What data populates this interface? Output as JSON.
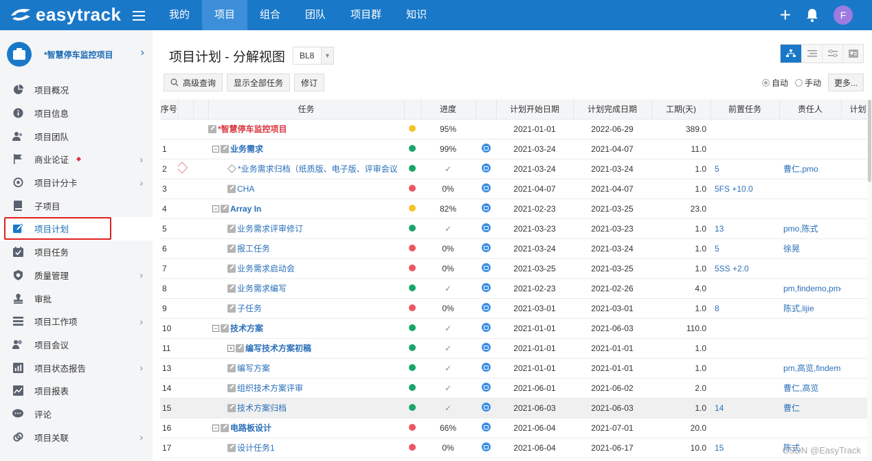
{
  "app": {
    "brand": "easytrack"
  },
  "nav": [
    {
      "label": "我的"
    },
    {
      "label": "项目",
      "active": true
    },
    {
      "label": "组合"
    },
    {
      "label": "团队"
    },
    {
      "label": "项目群"
    },
    {
      "label": "知识"
    }
  ],
  "user": {
    "avatar_letter": "F"
  },
  "project": {
    "name": "*智慧停车监控项目"
  },
  "sidebar": {
    "items": [
      {
        "label": "项目概况",
        "icon": "pie-chart-icon",
        "chevron": false
      },
      {
        "label": "项目信息",
        "icon": "info-icon",
        "chevron": false
      },
      {
        "label": "项目团队",
        "icon": "users-icon",
        "chevron": false
      },
      {
        "label": "商业论证",
        "icon": "flag-icon",
        "chevron": true,
        "badge": true
      },
      {
        "label": "项目计分卡",
        "icon": "target-icon",
        "chevron": true
      },
      {
        "label": "子项目",
        "icon": "book-icon",
        "chevron": false
      },
      {
        "label": "项目计划",
        "icon": "edit-icon",
        "chevron": false,
        "active": true
      },
      {
        "label": "项目任务",
        "icon": "calendar-check-icon",
        "chevron": false
      },
      {
        "label": "质量管理",
        "icon": "shield-icon",
        "chevron": true
      },
      {
        "label": "审批",
        "icon": "stamp-icon",
        "chevron": false
      },
      {
        "label": "项目工作项",
        "icon": "list-icon",
        "chevron": true
      },
      {
        "label": "项目会议",
        "icon": "meeting-icon",
        "chevron": false
      },
      {
        "label": "项目状态报告",
        "icon": "report-icon",
        "chevron": true
      },
      {
        "label": "项目报表",
        "icon": "line-chart-icon",
        "chevron": false
      },
      {
        "label": "评论",
        "icon": "comment-icon",
        "chevron": false
      },
      {
        "label": "项目关联",
        "icon": "link-icon",
        "chevron": true
      }
    ]
  },
  "main": {
    "title": "项目计划 - 分解视图",
    "baseline": "BL8",
    "toolbar": {
      "advanced_query": "高级查询",
      "show_all": "显示全部任务",
      "revise": "修订"
    },
    "mode": {
      "auto": "自动",
      "manual": "手动",
      "more": "更多..."
    }
  },
  "colors": {
    "accent": "#1a78c8",
    "green": "#19a56a",
    "yellow": "#f5c22b",
    "red": "#ee5562"
  },
  "table": {
    "headers": {
      "num": "序号",
      "task": "任务",
      "progress": "进度",
      "start": "计划开始日期",
      "end": "计划完成日期",
      "duration": "工期(天)",
      "pred": "前置任务",
      "owner": "责任人",
      "extra": "计划"
    },
    "rows": [
      {
        "num": "",
        "name": "*智慧停车监控项目",
        "level": 0,
        "tree": "",
        "style": "root",
        "status": "y",
        "progress": "95%",
        "ltype": false,
        "start": "2021-01-01",
        "end": "2022-06-29",
        "duration": "389.0",
        "pred": "",
        "owner": ""
      },
      {
        "num": "1",
        "name": "业务需求",
        "level": 1,
        "tree": "−",
        "style": "b",
        "status": "g",
        "progress": "99%",
        "ltype": true,
        "start": "2021-03-24",
        "end": "2021-04-07",
        "duration": "11.0",
        "pred": "",
        "owner": ""
      },
      {
        "num": "2",
        "name": "*业务需求归档（纸质版、电子版、评审会议",
        "level": 2,
        "tree": "",
        "style": "milestone",
        "status": "g",
        "progress": "✓",
        "ltype": true,
        "start": "2021-03-24",
        "end": "2021-03-24",
        "duration": "1.0",
        "pred": "5",
        "owner": "曹仁,pmo",
        "flag": true
      },
      {
        "num": "3",
        "name": "CHA",
        "level": 2,
        "tree": "",
        "style": "",
        "status": "r",
        "progress": "0%",
        "ltype": true,
        "start": "2021-04-07",
        "end": "2021-04-07",
        "duration": "1.0",
        "pred": "5FS +10.0",
        "owner": ""
      },
      {
        "num": "4",
        "name": "Array In",
        "level": 1,
        "tree": "−",
        "style": "b",
        "status": "y",
        "progress": "82%",
        "ltype": true,
        "start": "2021-02-23",
        "end": "2021-03-25",
        "duration": "23.0",
        "pred": "",
        "owner": ""
      },
      {
        "num": "5",
        "name": "业务需求评审修订",
        "level": 2,
        "tree": "",
        "style": "",
        "status": "g",
        "progress": "✓",
        "ltype": true,
        "start": "2021-03-23",
        "end": "2021-03-23",
        "duration": "1.0",
        "pred": "13",
        "owner": "pmo,陈式"
      },
      {
        "num": "6",
        "name": "报工任务",
        "level": 2,
        "tree": "",
        "style": "",
        "status": "r",
        "progress": "0%",
        "ltype": true,
        "start": "2021-03-24",
        "end": "2021-03-24",
        "duration": "1.0",
        "pred": "5",
        "owner": "徐晃"
      },
      {
        "num": "7",
        "name": "业务需求启动会",
        "level": 2,
        "tree": "",
        "style": "",
        "status": "r",
        "progress": "0%",
        "ltype": true,
        "start": "2021-03-25",
        "end": "2021-03-25",
        "duration": "1.0",
        "pred": "5SS +2.0",
        "owner": ""
      },
      {
        "num": "8",
        "name": "业务需求编写",
        "level": 2,
        "tree": "",
        "style": "",
        "status": "g",
        "progress": "✓",
        "ltype": true,
        "start": "2021-02-23",
        "end": "2021-02-26",
        "duration": "4.0",
        "pred": "",
        "owner": "pm,findemo,pmo"
      },
      {
        "num": "9",
        "name": "子任务",
        "level": 2,
        "tree": "",
        "style": "",
        "status": "r",
        "progress": "0%",
        "ltype": true,
        "start": "2021-03-01",
        "end": "2021-03-01",
        "duration": "1.0",
        "pred": "8",
        "owner": "陈式,lijie"
      },
      {
        "num": "10",
        "name": "技术方案",
        "level": 1,
        "tree": "−",
        "style": "b",
        "status": "g",
        "progress": "✓",
        "ltype": true,
        "start": "2021-01-01",
        "end": "2021-06-03",
        "duration": "110.0",
        "pred": "",
        "owner": ""
      },
      {
        "num": "11",
        "name": "编写技术方案初稿",
        "level": 2,
        "tree": "+",
        "style": "b",
        "status": "g",
        "progress": "✓",
        "ltype": true,
        "start": "2021-01-01",
        "end": "2021-01-01",
        "duration": "1.0",
        "pred": "",
        "owner": ""
      },
      {
        "num": "13",
        "name": "编写方案",
        "level": 2,
        "tree": "",
        "style": "",
        "status": "g",
        "progress": "✓",
        "ltype": true,
        "start": "2021-01-01",
        "end": "2021-01-01",
        "duration": "1.0",
        "pred": "",
        "owner": "pm,高览,findemo"
      },
      {
        "num": "14",
        "name": "组织技术方案评审",
        "level": 2,
        "tree": "",
        "style": "",
        "status": "g",
        "progress": "✓",
        "ltype": true,
        "start": "2021-06-01",
        "end": "2021-06-02",
        "duration": "2.0",
        "pred": "",
        "owner": "曹仁,高览"
      },
      {
        "num": "15",
        "name": "技术方案归档",
        "level": 2,
        "tree": "",
        "style": "",
        "status": "g",
        "progress": "✓",
        "ltype": true,
        "start": "2021-06-03",
        "end": "2021-06-03",
        "duration": "1.0",
        "pred": "14",
        "owner": "曹仁",
        "selected": true
      },
      {
        "num": "16",
        "name": "电路板设计",
        "level": 1,
        "tree": "−",
        "style": "b",
        "status": "r",
        "progress": "66%",
        "ltype": true,
        "start": "2021-06-04",
        "end": "2021-07-01",
        "duration": "20.0",
        "pred": "",
        "owner": ""
      },
      {
        "num": "17",
        "name": "设计任务1",
        "level": 2,
        "tree": "",
        "style": "",
        "status": "r",
        "progress": "0%",
        "ltype": true,
        "start": "2021-06-04",
        "end": "2021-06-17",
        "duration": "10.0",
        "pred": "15",
        "owner": "陈式"
      }
    ]
  },
  "watermark": "CSDN @EasyTrack"
}
